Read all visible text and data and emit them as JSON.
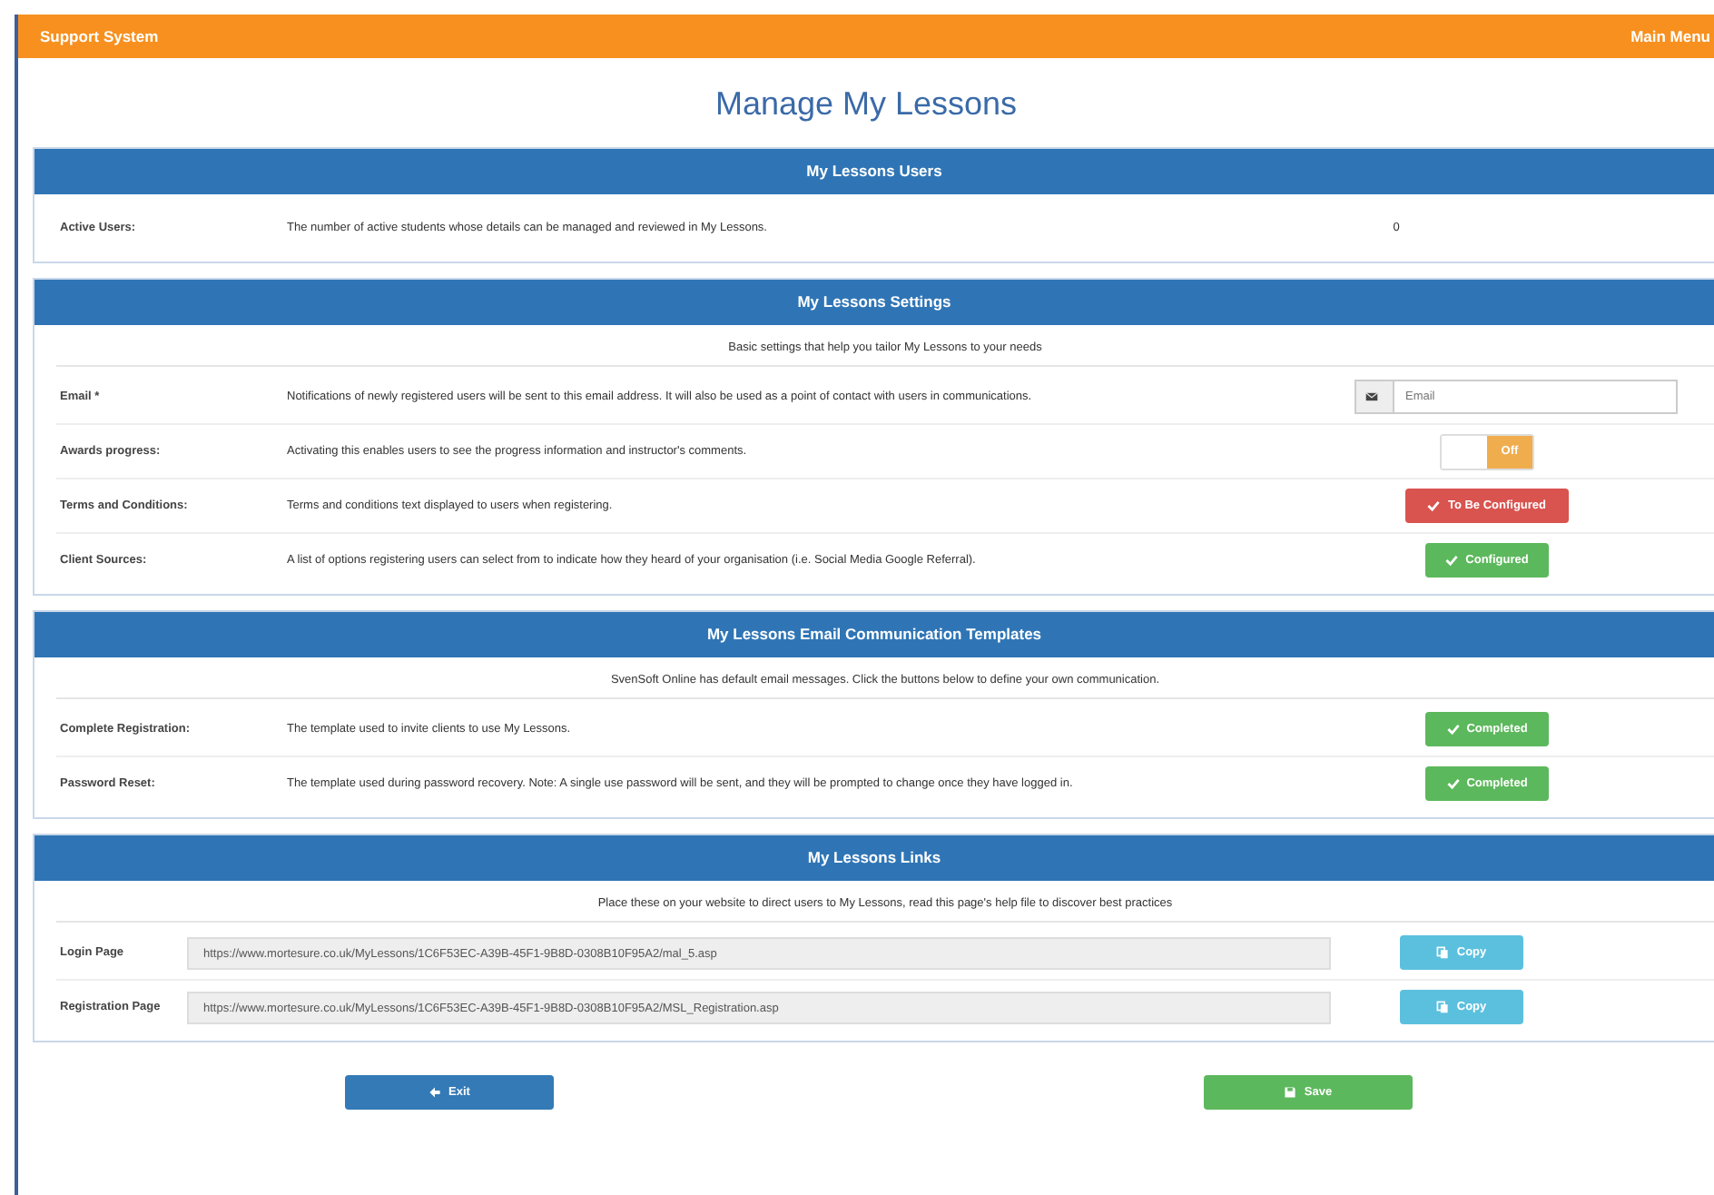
{
  "topbar": {
    "title": "Support System",
    "menu": "Main Menu"
  },
  "page_title": "Manage My Lessons",
  "panels": [
    {
      "title": "My Lessons Users",
      "rows": [
        {
          "kind": "value",
          "label": "Active Users:",
          "description": "The number of active students whose details can be managed and reviewed in My Lessons.",
          "value": "0"
        }
      ]
    },
    {
      "title": "My Lessons Settings",
      "intro": "Basic settings that help you tailor My Lessons to your needs",
      "rows": [
        {
          "kind": "email",
          "label": "Email *",
          "description": "Notifications of newly registered users will be sent to this email address. It will also be used as a point of contact with users in communications.",
          "placeholder": "Email"
        },
        {
          "kind": "toggle",
          "label": "Awards progress:",
          "description": "Activating this enables users to see the progress information and instructor's comments.",
          "toggle_label": "Off",
          "on": false
        },
        {
          "kind": "status",
          "label": "Terms and Conditions:",
          "description": "Terms and conditions text displayed to users when registering.",
          "button": "To Be Configured",
          "done": false
        },
        {
          "kind": "status",
          "label": "Client Sources:",
          "description": "A list of options registering users can select from to indicate how they heard of your organisation (i.e. Social Media Google Referral).",
          "button": "Configured",
          "done": true
        }
      ]
    },
    {
      "title": "My Lessons Email Communication Templates",
      "intro": "SvenSoft Online has default email messages. Click the buttons below to define your own communication.",
      "rows": [
        {
          "kind": "status",
          "label": "Complete Registration:",
          "description": "The template used to invite clients to use My Lessons.",
          "button": "Completed",
          "done": true
        },
        {
          "kind": "status",
          "label": "Password Reset:",
          "description": "The template used during password recovery. Note: A single use password will be sent, and they will be prompted to change once they have logged in.",
          "button": "Completed",
          "done": true
        }
      ]
    },
    {
      "title": "My Lessons Links",
      "intro": "Place these on your website to direct users to My Lessons, read this page's help file to discover best practices",
      "rows": [
        {
          "kind": "link",
          "label": "Login Page",
          "value": "https://www.mortesure.co.uk/MyLessons/1C6F53EC-A39B-45F1-9B8D-0308B10F95A2/mal_5.asp",
          "button": "Copy"
        },
        {
          "kind": "link",
          "label": "Registration Page",
          "value": "https://www.mortesure.co.uk/MyLessons/1C6F53EC-A39B-45F1-9B8D-0308B10F95A2/MSL_Registration.asp",
          "button": "Copy"
        }
      ]
    }
  ],
  "footer_buttons": [
    {
      "kind": "exit",
      "label": "Exit"
    },
    {
      "kind": "save",
      "label": "Save"
    }
  ]
}
